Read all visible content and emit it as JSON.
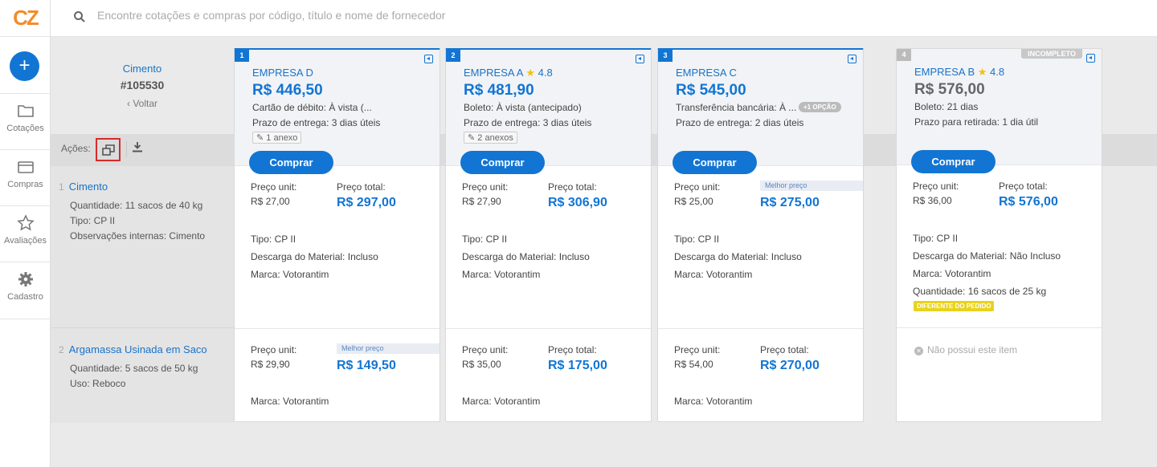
{
  "logo": "CZ",
  "search": {
    "placeholder": "Encontre cotações e compras por código, título e nome de fornecedor"
  },
  "nav": [
    {
      "label": "Cotações",
      "icon": "folder-icon"
    },
    {
      "label": "Compras",
      "icon": "card-icon"
    },
    {
      "label": "Avaliações",
      "icon": "star-icon"
    },
    {
      "label": "Cadastro",
      "icon": "gear-icon"
    }
  ],
  "header": {
    "category": "Cimento",
    "number": "#105530",
    "back": "‹ Voltar"
  },
  "actions": {
    "label": "Ações:"
  },
  "items": [
    {
      "index": "1",
      "title": "Cimento",
      "details": [
        {
          "k": "Quantidade:",
          "v": "11 sacos de 40 kg"
        },
        {
          "k": "Tipo:",
          "v": "CP II"
        },
        {
          "k": "Observações internas:",
          "v": "Cimento"
        }
      ]
    },
    {
      "index": "2",
      "title": "Argamassa Usinada em Saco",
      "details": [
        {
          "k": "Quantidade:",
          "v": "5 sacos de 50 kg"
        },
        {
          "k": "Uso:",
          "v": "Reboco"
        }
      ]
    }
  ],
  "common": {
    "buy": "Comprar",
    "unit": "Preço unit:",
    "total": "Preço total:",
    "best": "Melhor preço",
    "tipo": "Tipo:",
    "descarga": "Descarga do Material:",
    "marca": "Marca:",
    "quantidade": "Quantidade:",
    "diff": "DIFERENTE DO PEDIDO",
    "none": "Não possui este item",
    "incomplete": "INCOMPLETO"
  },
  "cards": [
    {
      "badge": "1",
      "supplier": "EMPRESA D",
      "rating": "",
      "price": "R$ 446,50",
      "payment": "Cartão de débito: À vista (...",
      "delivery": "Prazo de entrega: 3 dias úteis",
      "attachment": "1 anexo",
      "i1": {
        "unit": "R$ 27,00",
        "total": "R$ 297,00",
        "tipo": "CP II",
        "descarga": "Incluso",
        "marca": "Votorantim"
      },
      "i2": {
        "unit": "R$ 29,90",
        "total": "R$ 149,50",
        "marca": "Votorantim"
      }
    },
    {
      "badge": "2",
      "supplier": "EMPRESA A",
      "rating": "4.8",
      "price": "R$ 481,90",
      "payment": "Boleto: À vista (antecipado)",
      "delivery": "Prazo de entrega: 3 dias úteis",
      "attachment": "2 anexos",
      "i1": {
        "unit": "R$ 27,90",
        "total": "R$ 306,90",
        "tipo": "CP II",
        "descarga": "Incluso",
        "marca": "Votorantim"
      },
      "i2": {
        "unit": "R$ 35,00",
        "total": "R$ 175,00",
        "marca": "Votorantim"
      }
    },
    {
      "badge": "3",
      "supplier": "EMPRESA C",
      "rating": "",
      "price": "R$ 545,00",
      "payment": "Transferência bancária: À ...",
      "option": "+1 OPÇÃO",
      "delivery": "Prazo de entrega: 2 dias úteis",
      "i1": {
        "unit": "R$ 25,00",
        "total": "R$ 275,00",
        "tipo": "CP II",
        "descarga": "Incluso",
        "marca": "Votorantim"
      },
      "i2": {
        "unit": "R$ 54,00",
        "total": "R$ 270,00",
        "marca": "Votorantim"
      }
    },
    {
      "badge": "4",
      "supplier": "EMPRESA B",
      "rating": "4.8",
      "price": "R$ 576,00",
      "payment": "Boleto: 21 dias",
      "delivery": "Prazo para retirada: 1 dia útil",
      "i1": {
        "unit": "R$ 36,00",
        "total": "R$ 576,00",
        "tipo": "CP II",
        "descarga": "Não Incluso",
        "marca": "Votorantim",
        "quantidade": "16 sacos de 25 kg"
      }
    }
  ]
}
